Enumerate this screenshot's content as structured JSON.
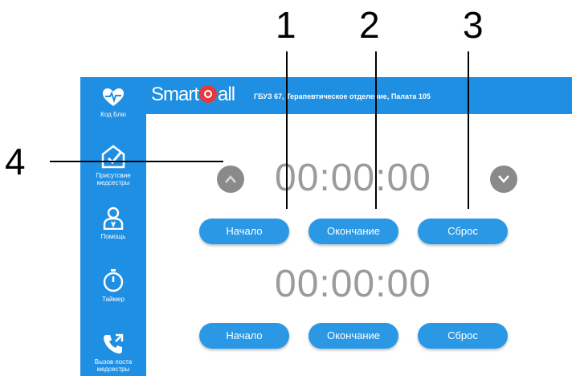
{
  "callouts": {
    "n1": "1",
    "n2": "2",
    "n3": "3",
    "n4": "4"
  },
  "app": {
    "logo": {
      "left": "Smart",
      "right": "all"
    },
    "subtitle": "ГБУЗ 67, Терапевтическое отделение, Палата 105",
    "sidebar": [
      {
        "icon": "heart-pulse-icon",
        "label": "Код Блю"
      },
      {
        "icon": "nurse-presence-icon",
        "label": "Присутсвие медсестры"
      },
      {
        "icon": "doctor-help-icon",
        "label": "Помощь"
      },
      {
        "icon": "stopwatch-icon",
        "label": "Таймер"
      },
      {
        "icon": "call-nurse-icon",
        "label": "Вызов поста медсестры"
      }
    ],
    "timers": [
      {
        "time": "00:00:00",
        "start": "Начало",
        "end": "Окончание",
        "reset": "Сброс"
      },
      {
        "time": "00:00:00",
        "start": "Начало",
        "end": "Окончание",
        "reset": "Сброс"
      }
    ]
  },
  "colors": {
    "brand_blue": "#1e8fe3",
    "button_blue": "#2b98e6",
    "timer_gray": "#9b9b9b",
    "logo_red": "#e63a3a"
  }
}
